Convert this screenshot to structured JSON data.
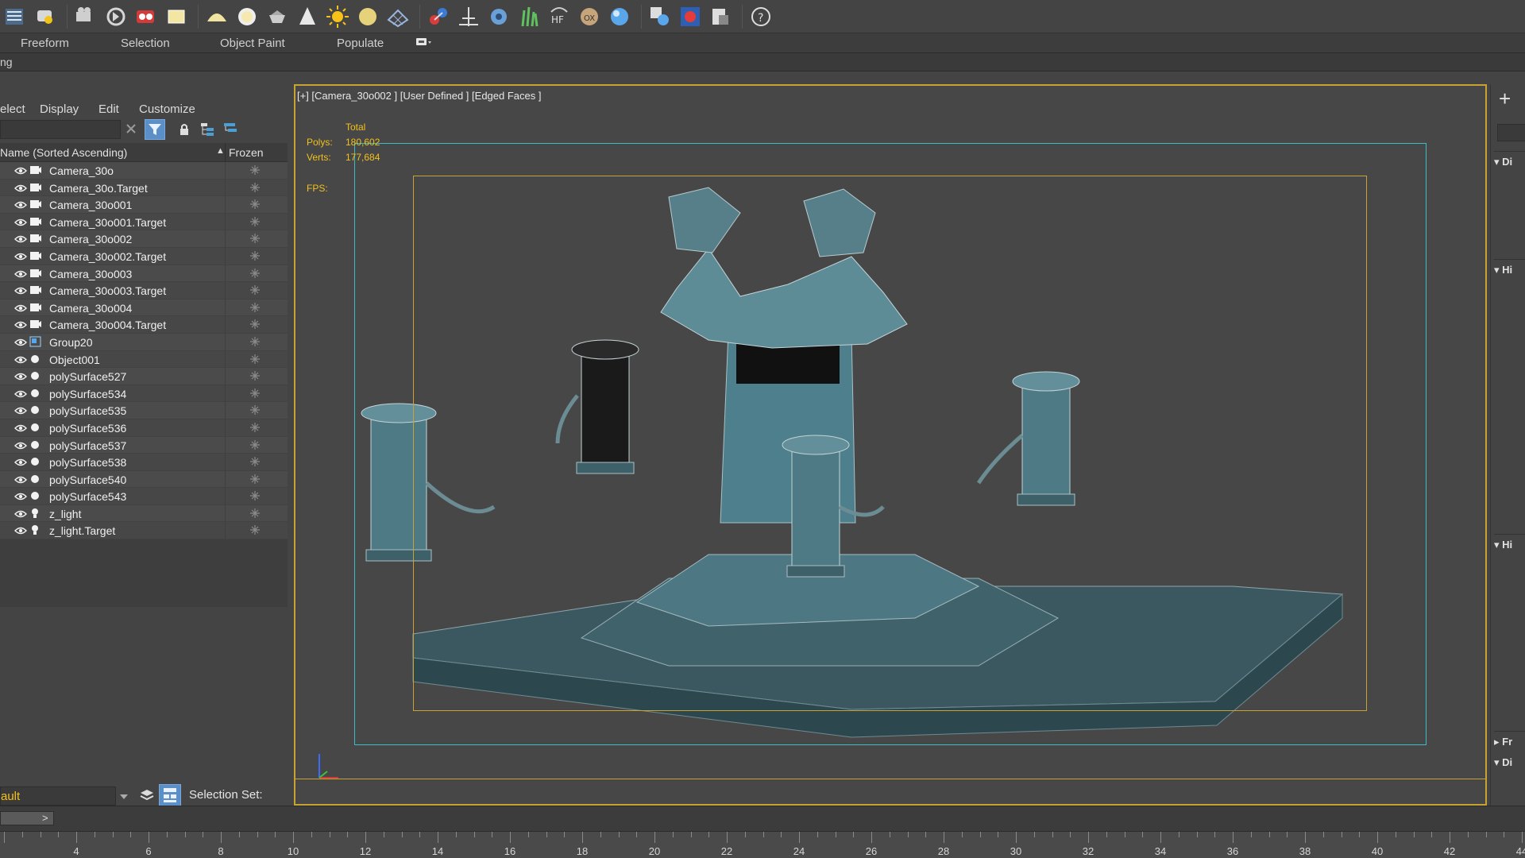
{
  "ribbon": {
    "tabs": [
      "Freeform",
      "Selection",
      "Object Paint",
      "Populate"
    ],
    "strip_label": "ng"
  },
  "explorer": {
    "menu": [
      "elect",
      "Display",
      "Edit",
      "Customize"
    ],
    "header": {
      "name": "Name (Sorted Ascending)",
      "sort_indicator": "▲",
      "frozen": "Frozen"
    },
    "items": [
      {
        "name": "Camera_30o",
        "type": "camera"
      },
      {
        "name": "Camera_30o.Target",
        "type": "camera"
      },
      {
        "name": "Camera_30o001",
        "type": "camera"
      },
      {
        "name": "Camera_30o001.Target",
        "type": "camera"
      },
      {
        "name": "Camera_30o002",
        "type": "camera"
      },
      {
        "name": "Camera_30o002.Target",
        "type": "camera"
      },
      {
        "name": "Camera_30o003",
        "type": "camera"
      },
      {
        "name": "Camera_30o003.Target",
        "type": "camera"
      },
      {
        "name": "Camera_30o004",
        "type": "camera"
      },
      {
        "name": "Camera_30o004.Target",
        "type": "camera"
      },
      {
        "name": "Group20",
        "type": "group"
      },
      {
        "name": "Object001",
        "type": "geometry"
      },
      {
        "name": "polySurface527",
        "type": "geometry"
      },
      {
        "name": "polySurface534",
        "type": "geometry"
      },
      {
        "name": "polySurface535",
        "type": "geometry"
      },
      {
        "name": "polySurface536",
        "type": "geometry"
      },
      {
        "name": "polySurface537",
        "type": "geometry"
      },
      {
        "name": "polySurface538",
        "type": "geometry"
      },
      {
        "name": "polySurface540",
        "type": "geometry"
      },
      {
        "name": "polySurface543",
        "type": "geometry"
      },
      {
        "name": "z_light",
        "type": "light"
      },
      {
        "name": "z_light.Target",
        "type": "light"
      }
    ],
    "layer_combo": "ault",
    "selection_set_label": "Selection Set:"
  },
  "viewport": {
    "label": "[+] [Camera_30o002 ] [User Defined ] [Edged Faces ]",
    "stats": {
      "total_label": "Total",
      "polys_label": "Polys:",
      "polys_value": "180,602",
      "verts_label": "Verts:",
      "verts_value": "177,684",
      "fps_label": "FPS:"
    },
    "colors": {
      "frame": "#c8a331",
      "safe_frame": "#3cbcc4",
      "stats_text": "#f2c11c",
      "model_teal": "#4d7f8c"
    }
  },
  "cmdpanel": {
    "add_symbol": "+",
    "rollouts": [
      "Di",
      "Hi",
      "Hi",
      "Fr",
      "Di"
    ]
  },
  "timeline": {
    "slider_arrow": ">",
    "ticks": [
      "4",
      "6",
      "8",
      "10",
      "12",
      "14",
      "16",
      "18",
      "20",
      "22",
      "24",
      "26",
      "28",
      "30",
      "32",
      "34",
      "36",
      "38",
      "40",
      "42",
      "44"
    ]
  },
  "toolbar": {
    "icons": [
      "menu-icon",
      "teapot-icon",
      "render-setup-icon",
      "motion-icon",
      "render-frame-icon",
      "box-icon",
      "dome-icon",
      "sphere-icon",
      "teapot-shape-icon",
      "cone-icon",
      "sun-icon",
      "circle-light-icon",
      "grid-icon",
      "molecule-icon",
      "constraint-icon",
      "gear-cloud-icon",
      "grass-icon",
      "hf-icon",
      "ox-icon",
      "material-sphere-icon",
      "material-editor-icon",
      "render-icon",
      "explorer-icon",
      "help-icon"
    ]
  }
}
